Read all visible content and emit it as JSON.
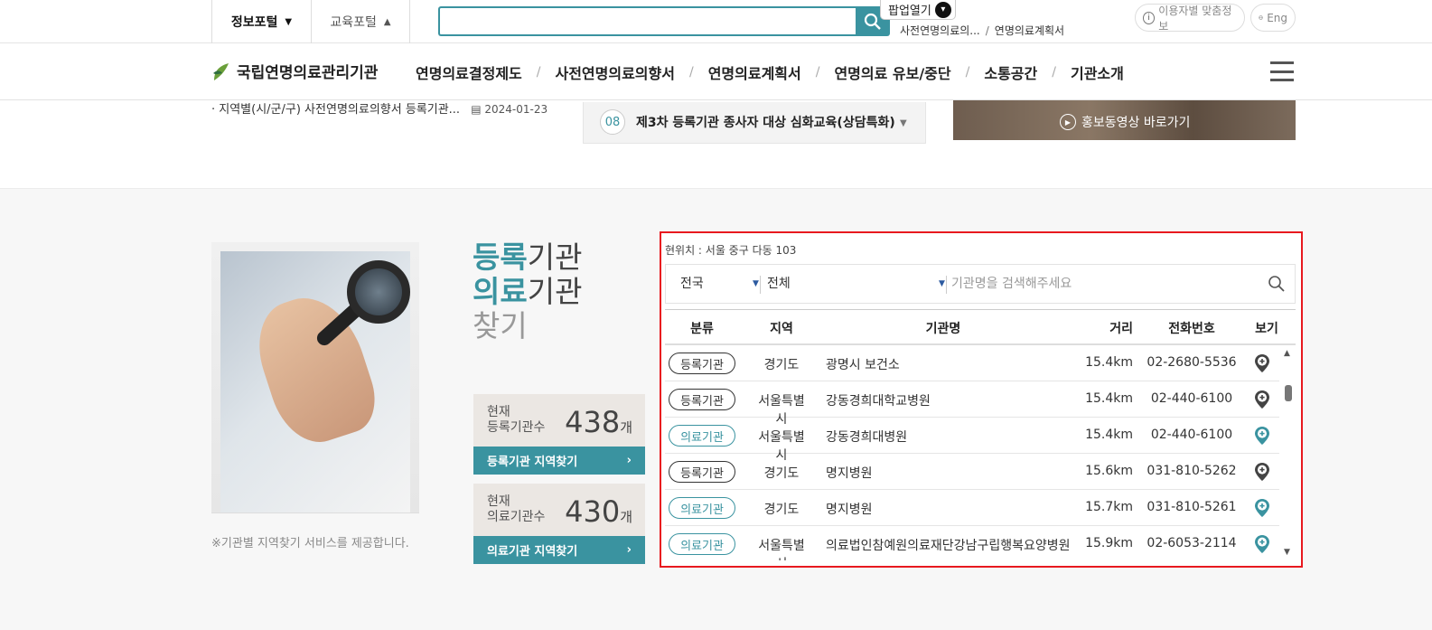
{
  "topbar": {
    "portal_info": "정보포털",
    "portal_info_caret": "▼",
    "portal_edu": "교육포털",
    "portal_edu_caret": "▲",
    "search_value": "",
    "popup_label": "팝업열기",
    "breadcrumb": [
      "사전연명의료의...",
      "연명의료계획서"
    ],
    "breadcrumb_sep": "/",
    "user_info": "이용자별 맞춤정보",
    "lang": "Eng"
  },
  "gnb": {
    "logo": "국립연명의료관리기관",
    "items": [
      "연명의료결정제도",
      "사전연명의료의향서",
      "연명의료계획서",
      "연명의료 유보/중단",
      "소통공간",
      "기관소개"
    ],
    "sep": "/"
  },
  "prev_section": {
    "notice_title": "· 지역별(시/군/구) 사전연명의료의향서 등록기관...",
    "notice_date": "2024-01-23",
    "schedule_num": "08",
    "schedule_title": "제3차 등록기관 종사자 대상 심화교육(상담특화)",
    "video_label": "홍보동영상 바로가기"
  },
  "finder": {
    "heading_line1_hl": "등록",
    "heading_line1_rest": "기관",
    "heading_line2_hl": "의료",
    "heading_line2_rest": "기관",
    "heading_line3": "찾기",
    "caption": "※기관별 지역찾기 서비스를 제공합니다.",
    "counts": [
      {
        "label_l1": "현재",
        "label_l2": "등록기관수",
        "value": "438",
        "unit": "개",
        "button": "등록기관 지역찾기",
        "arrow": "›"
      },
      {
        "label_l1": "현재",
        "label_l2": "의료기관수",
        "value": "430",
        "unit": "개",
        "button": "의료기관 지역찾기",
        "arrow": "›"
      }
    ]
  },
  "panel": {
    "location": "현위치 : 서울 중구 다동 103",
    "region_select": "전국",
    "type_select": "전체",
    "keyword_placeholder": "기관명을 검색해주세요",
    "columns": [
      "분류",
      "지역",
      "기관명",
      "거리",
      "전화번호",
      "보기"
    ],
    "rows": [
      {
        "type": "등록기관",
        "kind": "reg",
        "region": "경기도",
        "name": "광명시 보건소",
        "dist": "15.4km",
        "tel": "02-2680-5536"
      },
      {
        "type": "등록기관",
        "kind": "reg",
        "region": "서울특별시",
        "name": "강동경희대학교병원",
        "dist": "15.4km",
        "tel": "02-440-6100"
      },
      {
        "type": "의료기관",
        "kind": "med",
        "region": "서울특별시",
        "name": "강동경희대병원",
        "dist": "15.4km",
        "tel": "02-440-6100"
      },
      {
        "type": "등록기관",
        "kind": "reg",
        "region": "경기도",
        "name": "명지병원",
        "dist": "15.6km",
        "tel": "031-810-5262"
      },
      {
        "type": "의료기관",
        "kind": "med",
        "region": "경기도",
        "name": "명지병원",
        "dist": "15.7km",
        "tel": "031-810-5261"
      },
      {
        "type": "의료기관",
        "kind": "med",
        "region": "서울특별시",
        "name": "의료법인참예원의료재단강남구립행복요양병원",
        "dist": "15.9km",
        "tel": "02-6053-2114"
      }
    ],
    "colors": {
      "reg": "#333333",
      "med": "#3a93a0",
      "accent": "#3a93a0",
      "highlight": "#e8191f"
    }
  }
}
